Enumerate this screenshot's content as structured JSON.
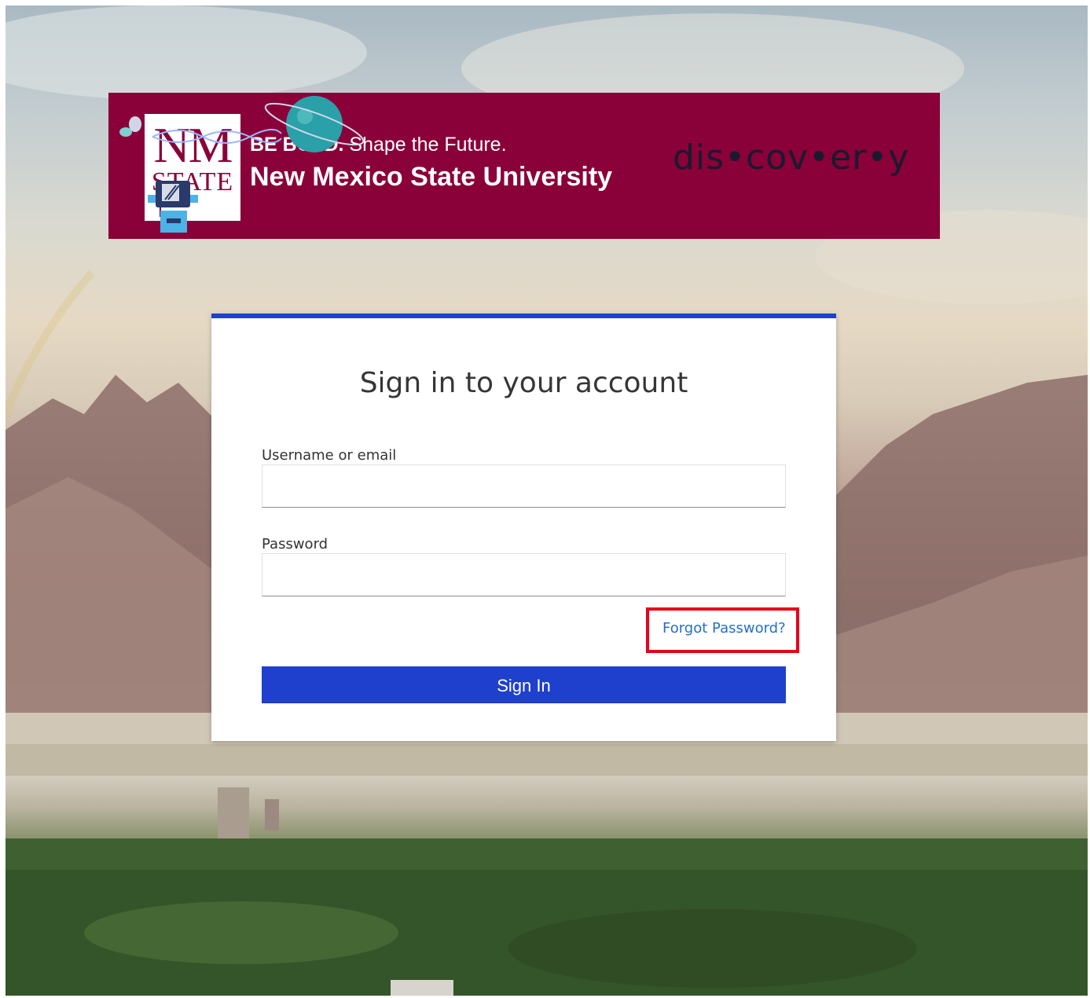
{
  "banner": {
    "logo_nm": "NM",
    "logo_state": "STATE",
    "tagline_bold": "BE BOLD.",
    "tagline_rest": " Shape the Future.",
    "university": "New Mexico State University",
    "discovery": "dis•cov•er•y"
  },
  "form": {
    "title": "Sign in to your account",
    "username_label": "Username or email",
    "username_value": "",
    "password_label": "Password",
    "password_value": "",
    "forgot_link": "Forgot Password?",
    "submit_label": "Sign In"
  },
  "colors": {
    "brand": "#8a0039",
    "accent": "#1e40cc",
    "link": "#1e6fd0",
    "highlight": "#e8001c"
  }
}
